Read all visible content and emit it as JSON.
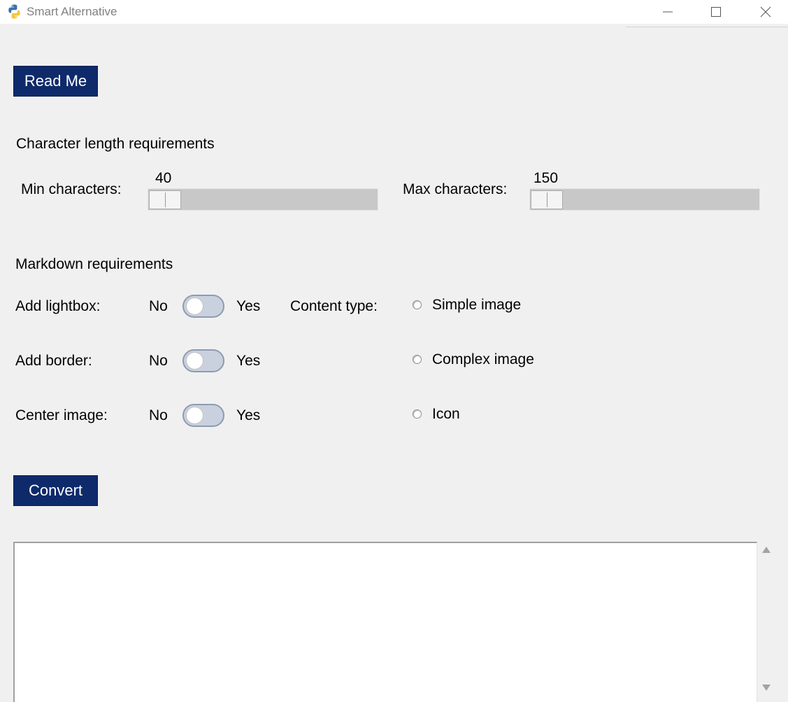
{
  "window": {
    "title": "Smart Alternative",
    "icon": "python-icon"
  },
  "buttons": {
    "read_me": "Read Me",
    "convert": "Convert"
  },
  "character_section": {
    "heading": "Character length requirements",
    "min_label": "Min characters:",
    "min_value": "40",
    "max_label": "Max characters:",
    "max_value": "150"
  },
  "markdown_section": {
    "heading": "Markdown requirements",
    "options": [
      {
        "label": "Add lightbox:",
        "off_label": "No",
        "on_label": "Yes",
        "enabled": false
      },
      {
        "label": "Add border:",
        "off_label": "No",
        "on_label": "Yes",
        "enabled": false
      },
      {
        "label": "Center image:",
        "off_label": "No",
        "on_label": "Yes",
        "enabled": false
      }
    ],
    "content_type_label": "Content type:",
    "content_types": [
      "Simple image",
      "Complex image",
      "Icon"
    ],
    "selected_content_type": null
  },
  "output": {
    "text": ""
  },
  "colors": {
    "button_bg": "#0f2a6b",
    "button_text": "#ffffff",
    "window_bg": "#f0f0f0",
    "toggle_track": "#c9d1de"
  }
}
